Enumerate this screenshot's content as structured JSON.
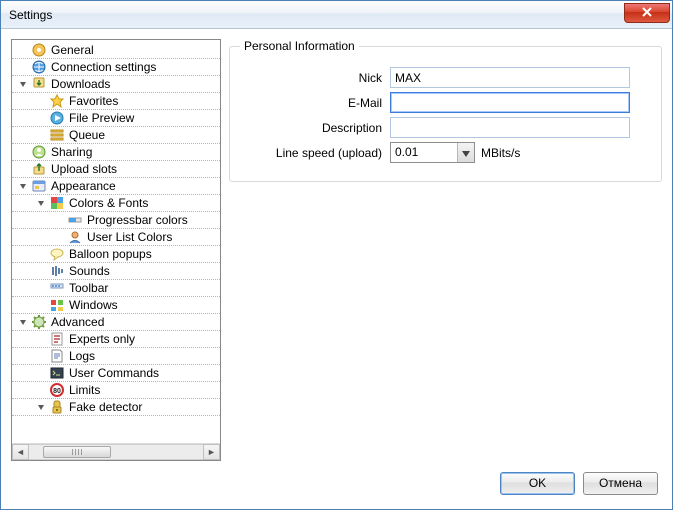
{
  "window": {
    "title": "Settings"
  },
  "tree": {
    "items": [
      {
        "d": 0,
        "exp": null,
        "icon": "general",
        "label": "General"
      },
      {
        "d": 0,
        "exp": null,
        "icon": "connection",
        "label": "Connection settings"
      },
      {
        "d": 0,
        "exp": "open",
        "icon": "downloads",
        "label": "Downloads"
      },
      {
        "d": 1,
        "exp": null,
        "icon": "favorites",
        "label": "Favorites"
      },
      {
        "d": 1,
        "exp": null,
        "icon": "preview",
        "label": "File Preview"
      },
      {
        "d": 1,
        "exp": null,
        "icon": "queue",
        "label": "Queue"
      },
      {
        "d": 0,
        "exp": null,
        "icon": "sharing",
        "label": "Sharing"
      },
      {
        "d": 0,
        "exp": null,
        "icon": "uploadslots",
        "label": "Upload slots"
      },
      {
        "d": 0,
        "exp": "open",
        "icon": "appearance",
        "label": "Appearance"
      },
      {
        "d": 1,
        "exp": "open",
        "icon": "colorsfonts",
        "label": "Colors & Fonts"
      },
      {
        "d": 2,
        "exp": null,
        "icon": "progressbar",
        "label": "Progressbar colors"
      },
      {
        "d": 2,
        "exp": null,
        "icon": "userlistcolors",
        "label": "User List Colors"
      },
      {
        "d": 1,
        "exp": null,
        "icon": "balloon",
        "label": "Balloon popups"
      },
      {
        "d": 1,
        "exp": null,
        "icon": "sounds",
        "label": "Sounds"
      },
      {
        "d": 1,
        "exp": null,
        "icon": "toolbar",
        "label": "Toolbar"
      },
      {
        "d": 1,
        "exp": null,
        "icon": "windows",
        "label": "Windows"
      },
      {
        "d": 0,
        "exp": "open",
        "icon": "advanced",
        "label": "Advanced"
      },
      {
        "d": 1,
        "exp": null,
        "icon": "experts",
        "label": "Experts only"
      },
      {
        "d": 1,
        "exp": null,
        "icon": "logs",
        "label": "Logs"
      },
      {
        "d": 1,
        "exp": null,
        "icon": "usercommands",
        "label": "User Commands"
      },
      {
        "d": 1,
        "exp": null,
        "icon": "limits",
        "label": "Limits"
      },
      {
        "d": 1,
        "exp": "open",
        "icon": "fakedetector",
        "label": "Fake detector"
      }
    ]
  },
  "group": {
    "legend": "Personal Information",
    "nick_label": "Nick",
    "nick_value": "MAX",
    "email_label": "E-Mail",
    "email_value": "",
    "desc_label": "Description",
    "desc_value": "",
    "speed_label": "Line speed (upload)",
    "speed_value": "0.01",
    "speed_unit": "MBits/s"
  },
  "buttons": {
    "ok": "OK",
    "cancel": "Отмена"
  }
}
